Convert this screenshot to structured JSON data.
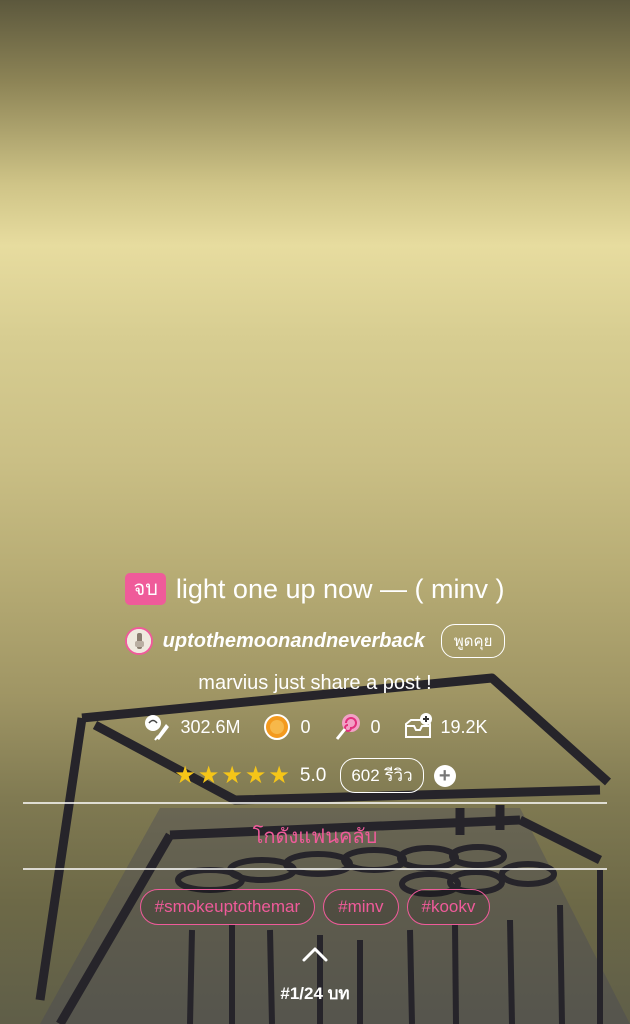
{
  "story": {
    "status_badge": "จบ",
    "title": "light one up now — ( minv )",
    "author": "uptothemoonandneverback",
    "chat_label": "พูดคุย",
    "subtitle": "marvius just share a post !"
  },
  "stats": {
    "views": "302.6M",
    "coins": "0",
    "candies": "0",
    "favorites": "19.2K"
  },
  "rating": {
    "score": "5.0",
    "stars": 5,
    "reviews_label": "602 รีวิว",
    "add_symbol": "+"
  },
  "fanclub_label": "โกดังแฟนคลับ",
  "tags": [
    "#smokeuptothemar",
    "#minv",
    "#kookv"
  ],
  "chapter_indicator": "#1/24 บท",
  "colors": {
    "accent": "#ef5b9a",
    "star": "#f5c518",
    "text": "#ffffff"
  },
  "icons": {
    "views": "views-icon",
    "coins": "coin-icon",
    "candies": "lollipop-icon",
    "favorites": "add-to-shelf-icon",
    "expand": "chevron-up-icon"
  }
}
